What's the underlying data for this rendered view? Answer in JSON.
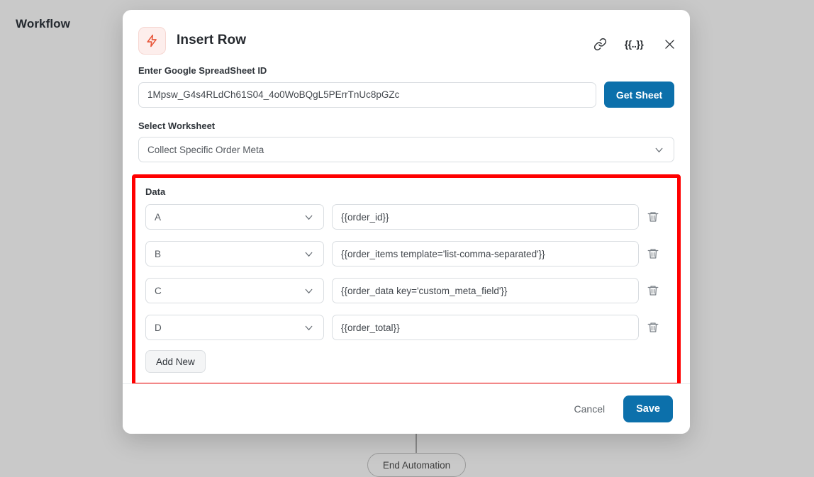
{
  "background": {
    "workflow_label": "Workflow",
    "end_node_label": "End Automation"
  },
  "modal": {
    "title": "Insert Row",
    "icon": "lightning-bolt-icon",
    "header_actions": [
      {
        "name": "link-icon",
        "label": ""
      },
      {
        "name": "merge-tag-icon",
        "label": "{{..}}"
      },
      {
        "name": "close-icon",
        "label": ""
      }
    ],
    "spreadsheet": {
      "label": "Enter Google SpreadSheet ID",
      "value": "1Mpsw_G4s4RLdCh61S04_4o0WoBQgL5PErrTnUc8pGZc",
      "placeholder": "Enter Google SpreadSheet ID",
      "button_label": "Get Sheet"
    },
    "worksheet": {
      "label": "Select Worksheet",
      "value": "Collect Specific Order Meta"
    },
    "data": {
      "label": "Data",
      "add_new_label": "Add New",
      "highlight_color": "#ff0000",
      "rows": [
        {
          "column": "A",
          "value": "{{order_id}}"
        },
        {
          "column": "B",
          "value": "{{order_items template='list-comma-separated'}}"
        },
        {
          "column": "C",
          "value": "{{order_data key='custom_meta_field'}}"
        },
        {
          "column": "D",
          "value": "{{order_total}}"
        }
      ]
    },
    "footer": {
      "cancel_label": "Cancel",
      "save_label": "Save"
    }
  },
  "colors": {
    "primary": "#0c70ab",
    "highlight": "#ff0000",
    "icon_bg": "#fdeeec",
    "icon_fg": "#e8563a"
  }
}
